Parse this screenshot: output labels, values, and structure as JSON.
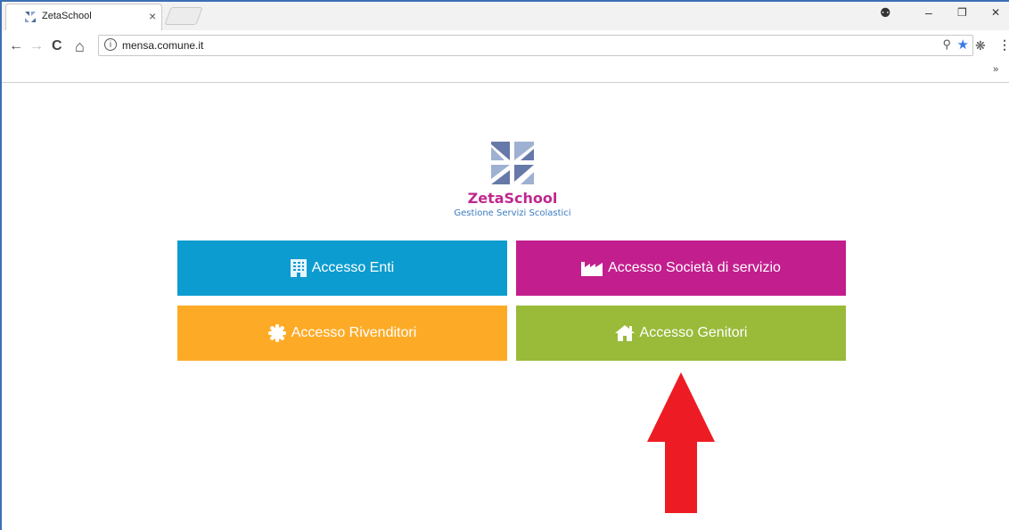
{
  "browser": {
    "tab_title": "ZetaSchool",
    "tab_close": "×",
    "url": "mensa.comune.it",
    "more_bookmarks": "»",
    "controls": {
      "profile": "⚉",
      "minimize": "–",
      "restore": "❐",
      "close": "✕"
    },
    "nav": {
      "back": "←",
      "forward": "→",
      "reload": "C",
      "home": "⌂"
    }
  },
  "logo": {
    "title": "ZetaSchool",
    "subtitle": "Gestione Servizi Scolastici"
  },
  "tiles": {
    "enti": {
      "label": "Accesso Enti",
      "color": "#0d9ccf",
      "icon": "building-icon"
    },
    "societa": {
      "label": "Accesso Società di servizio",
      "color": "#c21e8e",
      "icon": "factory-icon"
    },
    "rivenditori": {
      "label": "Accesso Rivenditori",
      "color": "#fdab27",
      "icon": "certificate-icon"
    },
    "genitori": {
      "label": "Accesso Genitori",
      "color": "#9aba3a",
      "icon": "home-icon"
    }
  },
  "annotation": {
    "color": "#ed1c24",
    "icon": "up-arrow-icon"
  }
}
